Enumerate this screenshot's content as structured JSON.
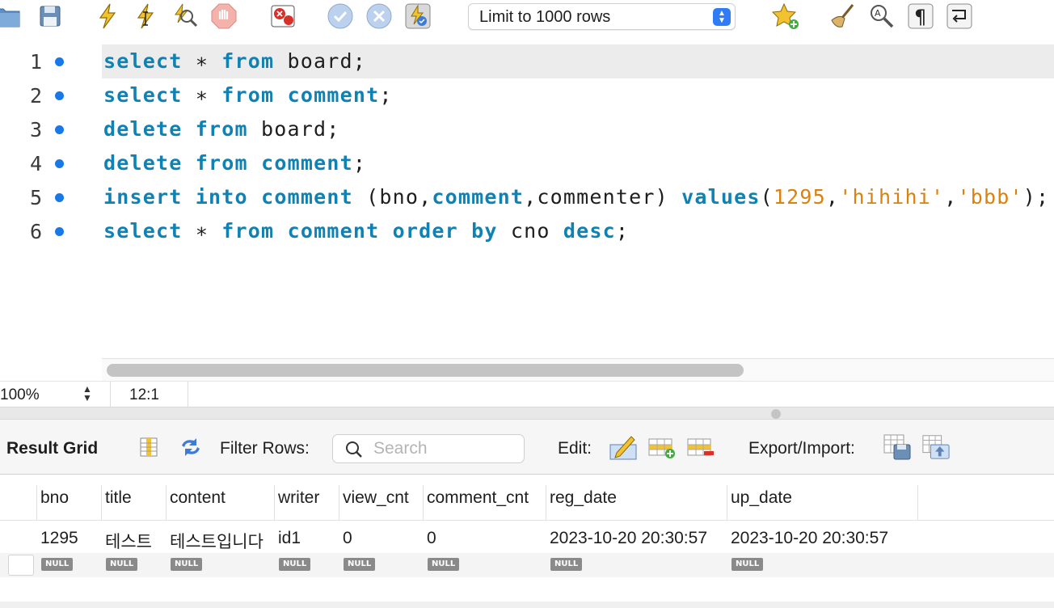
{
  "toolbar": {
    "limit_select": "Limit to 1000 rows",
    "icons": [
      "open-folder-icon",
      "save-script-icon",
      "execute-icon",
      "execute-current-icon",
      "explain-icon",
      "stop-icon",
      "toggle-error-stop-icon",
      "commit-icon",
      "rollback-icon",
      "autocommit-icon",
      "bookmark-add-icon",
      "beautify-icon",
      "find-icon",
      "invisible-chars-icon",
      "wrap-lines-icon"
    ]
  },
  "editor": {
    "lines": [
      {
        "no": "1",
        "tokens": [
          {
            "t": "select",
            "c": "kw"
          },
          {
            "t": " ∗ ",
            "c": "plain"
          },
          {
            "t": "from",
            "c": "kw"
          },
          {
            "t": " board;",
            "c": "plain"
          }
        ]
      },
      {
        "no": "2",
        "tokens": [
          {
            "t": "select",
            "c": "kw"
          },
          {
            "t": " ∗ ",
            "c": "plain"
          },
          {
            "t": "from",
            "c": "kw"
          },
          {
            "t": " ",
            "c": "plain"
          },
          {
            "t": "comment",
            "c": "kw"
          },
          {
            "t": ";",
            "c": "plain"
          }
        ]
      },
      {
        "no": "3",
        "tokens": [
          {
            "t": "delete",
            "c": "kw"
          },
          {
            "t": " ",
            "c": "plain"
          },
          {
            "t": "from",
            "c": "kw"
          },
          {
            "t": " board;",
            "c": "plain"
          }
        ]
      },
      {
        "no": "4",
        "tokens": [
          {
            "t": "delete",
            "c": "kw"
          },
          {
            "t": " ",
            "c": "plain"
          },
          {
            "t": "from",
            "c": "kw"
          },
          {
            "t": " ",
            "c": "plain"
          },
          {
            "t": "comment",
            "c": "kw"
          },
          {
            "t": ";",
            "c": "plain"
          }
        ]
      },
      {
        "no": "5",
        "tokens": [
          {
            "t": "insert",
            "c": "kw"
          },
          {
            "t": " ",
            "c": "plain"
          },
          {
            "t": "into",
            "c": "kw"
          },
          {
            "t": " ",
            "c": "plain"
          },
          {
            "t": "comment",
            "c": "kw"
          },
          {
            "t": " (bno,",
            "c": "plain"
          },
          {
            "t": "comment",
            "c": "kw"
          },
          {
            "t": ",commenter) ",
            "c": "plain"
          },
          {
            "t": "values",
            "c": "kw"
          },
          {
            "t": "(",
            "c": "plain"
          },
          {
            "t": "1295",
            "c": "num"
          },
          {
            "t": ",",
            "c": "plain"
          },
          {
            "t": "'hihihi'",
            "c": "str"
          },
          {
            "t": ",",
            "c": "plain"
          },
          {
            "t": "'bbb'",
            "c": "str"
          },
          {
            "t": ");",
            "c": "plain"
          }
        ]
      },
      {
        "no": "6",
        "tokens": [
          {
            "t": "select",
            "c": "kw"
          },
          {
            "t": " ∗ ",
            "c": "plain"
          },
          {
            "t": "from",
            "c": "kw"
          },
          {
            "t": " ",
            "c": "plain"
          },
          {
            "t": "comment",
            "c": "kw"
          },
          {
            "t": " ",
            "c": "plain"
          },
          {
            "t": "order",
            "c": "kw"
          },
          {
            "t": " ",
            "c": "plain"
          },
          {
            "t": "by",
            "c": "kw"
          },
          {
            "t": " cno ",
            "c": "plain"
          },
          {
            "t": "desc",
            "c": "kw"
          },
          {
            "t": ";",
            "c": "plain"
          }
        ]
      }
    ],
    "current_line": 1
  },
  "statusbar": {
    "zoom": "100%",
    "cursor": "12:1"
  },
  "result": {
    "grid_label": "Result Grid",
    "filter_label": "Filter Rows:",
    "search_placeholder": "Search",
    "edit_label": "Edit:",
    "export_label": "Export/Import:",
    "columns": [
      "bno",
      "title",
      "content",
      "writer",
      "view_cnt",
      "comment_cnt",
      "reg_date",
      "up_date"
    ],
    "rows": [
      [
        "1295",
        "테스트",
        "테스트입니다",
        "id1",
        "0",
        "0",
        "2023-10-20 20:30:57",
        "2023-10-20 20:30:57"
      ]
    ],
    "null_label": "NULL"
  }
}
